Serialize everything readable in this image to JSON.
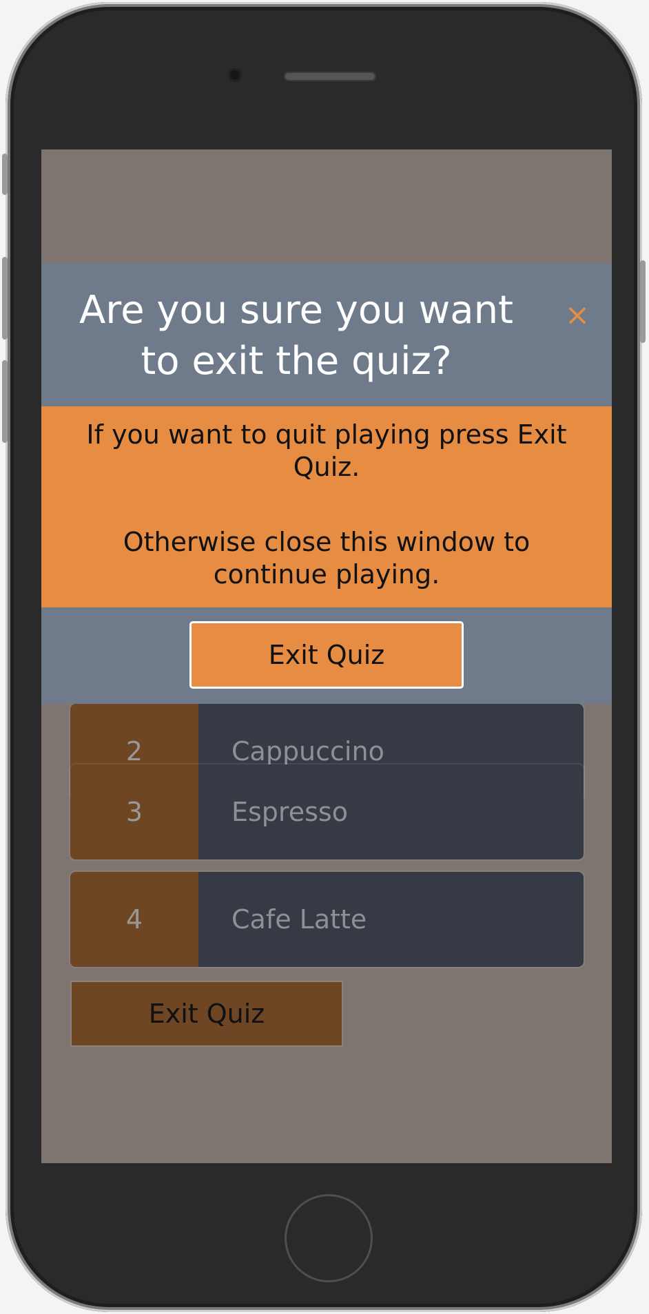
{
  "quiz": {
    "answers": [
      {
        "number": "2",
        "label": "Cappuccino"
      },
      {
        "number": "3",
        "label": "Espresso"
      },
      {
        "number": "4",
        "label": "Cafe Latte"
      }
    ],
    "exit_label": "Exit Quiz"
  },
  "modal": {
    "title": "Are you sure you want to exit the quiz?",
    "close_icon": "×",
    "body_line1": "If you want to quit playing press Exit Quiz.",
    "body_line2": "Otherwise close this window to continue playing.",
    "exit_label": "Exit Quiz"
  },
  "colors": {
    "overlay": "#7e7570",
    "modal_header": "#6f7b8b",
    "modal_body": "#e68c43",
    "answer_number_bg": "#6e4623",
    "answer_bg": "#353a44"
  }
}
